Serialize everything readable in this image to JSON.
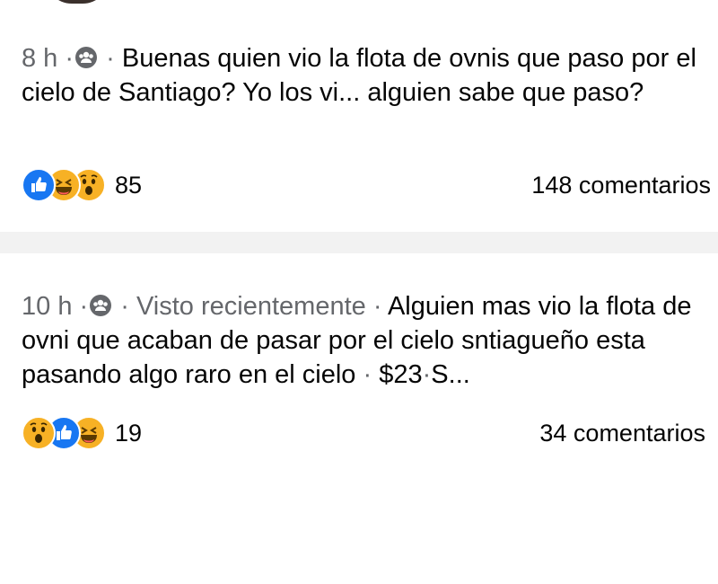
{
  "posts": [
    {
      "time": "8 h",
      "separator": "·",
      "text": "Buenas quien vio la flota de ovnis que paso por el cielo de Santiago? Yo los vi... alguien sabe que paso?",
      "reactions": [
        "like-icon",
        "haha-icon",
        "wow-icon"
      ],
      "reaction_count": "85",
      "comments": "148 comentarios"
    },
    {
      "time": "10 h",
      "separator": "·",
      "tag": "Visto recientemente",
      "text": "Alguien mas vio la flota de ovni que acaban de pasar por el cielo sntiagueño esta pasando algo raro en el cielo",
      "price": "$23",
      "suffix": "S...",
      "reactions": [
        "wow-icon",
        "like-icon",
        "haha-icon"
      ],
      "reaction_count": "19",
      "comments": "34 comentarios"
    }
  ],
  "colors": {
    "like": "#1877f2",
    "emoji_yellow": "#f7b125",
    "meta_gray": "#65676b",
    "text": "#050505"
  }
}
